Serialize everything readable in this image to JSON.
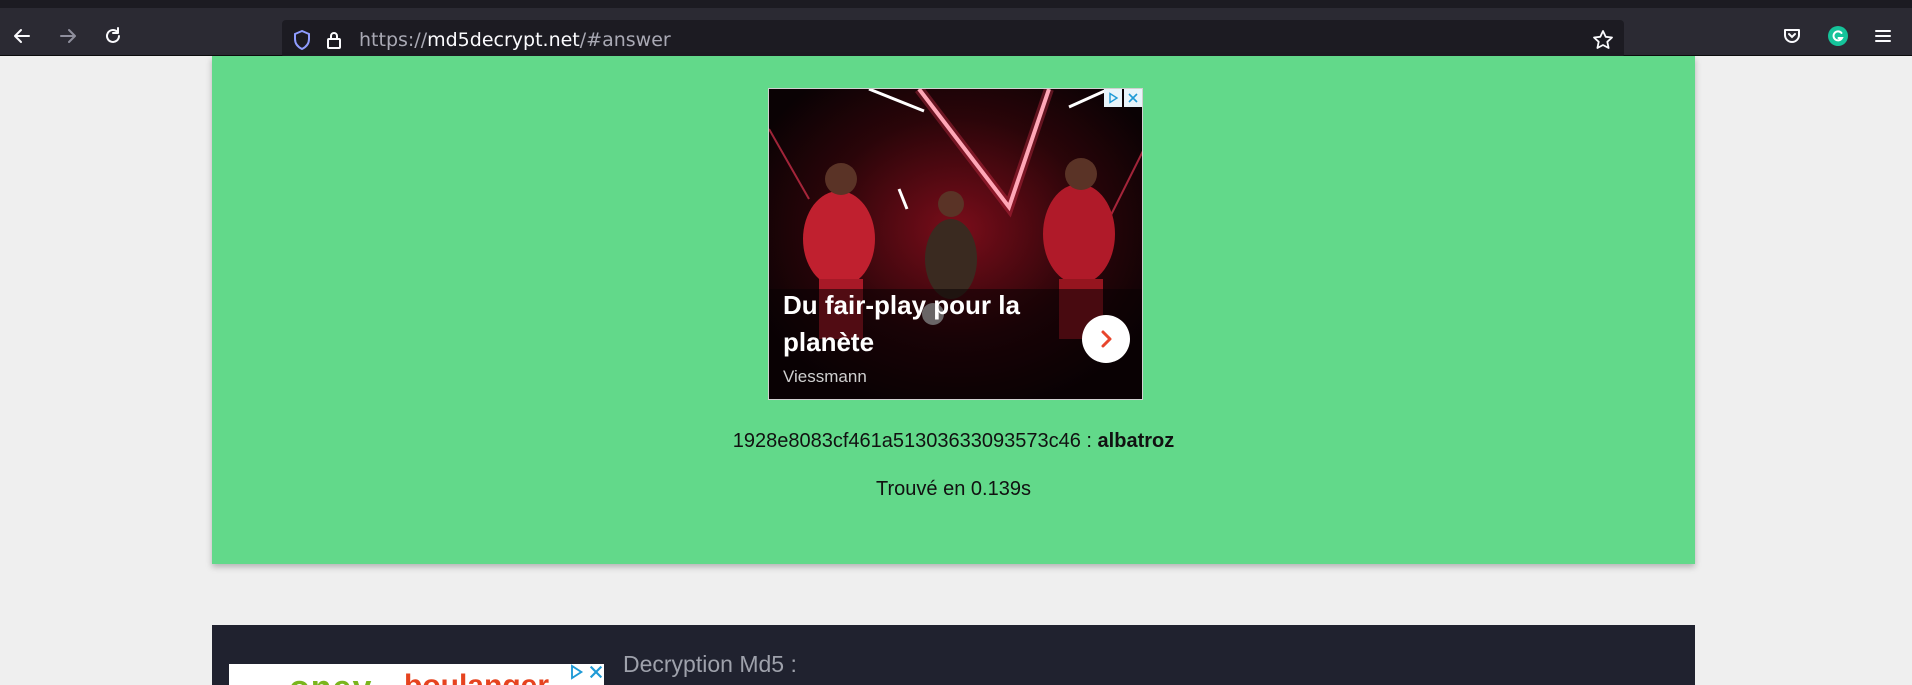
{
  "browser": {
    "url_base": "https://",
    "url_domain": "md5decrypt.net",
    "url_path": "/#answer",
    "icons": [
      "back-icon",
      "forward-icon",
      "reload-icon",
      "shield-icon",
      "lock-icon",
      "bookmark-star-icon",
      "pocket-icon",
      "grammarly-icon",
      "menu-icon"
    ]
  },
  "ad": {
    "headline": "Du fair-play pour la planète",
    "brand": "Viessmann"
  },
  "answer": {
    "hash": "1928e8083cf461a51303633093573c46 : ",
    "plaintext": "albatroz",
    "found_in": "Trouvé en 0.139s"
  },
  "section2": {
    "title": "Decryption Md5 :",
    "ad_text_1": "oney",
    "ad_text_2": "boulanger"
  },
  "colors": {
    "green_card": "#62d98a",
    "dark_card": "#20222f",
    "toolbar": "#2b2a33"
  }
}
